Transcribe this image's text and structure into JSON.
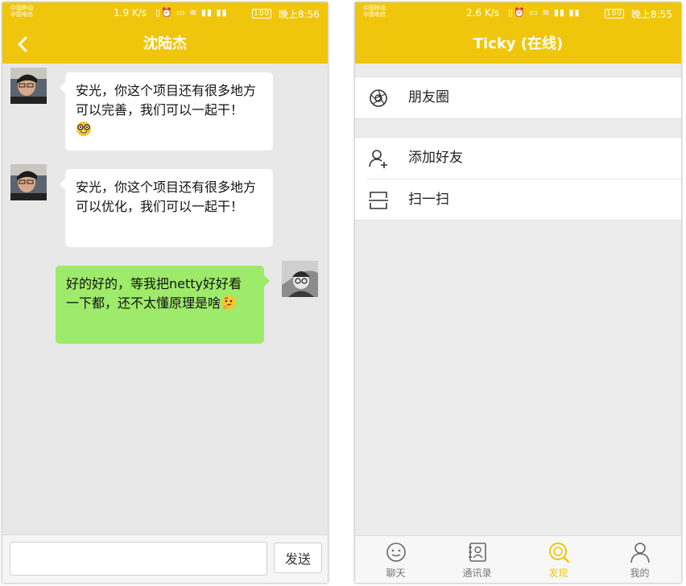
{
  "colors": {
    "accent": "#f0c60c",
    "sent_bubble": "#9eea6a",
    "received_bubble": "#ffffff",
    "chat_bg": "#e8e8e8"
  },
  "chat": {
    "status": {
      "carrier_1": "中国移动",
      "carrier_2": "中国电信",
      "speed": "1.9 K/s",
      "time": "晚上8:56",
      "battery": "100"
    },
    "title": "沈陆杰",
    "messages": [
      {
        "from": "friend",
        "text": "安光，你这个项目还有很多地方可以完善，我们可以一起干！",
        "emoji": "nerd-face"
      },
      {
        "from": "friend",
        "text": "安光，你这个项目还有很多地方可以优化，我们可以一起干！",
        "emoji": ""
      },
      {
        "from": "me",
        "text": "好的好的，等我把netty好好看一下都，还不太懂原理是啥",
        "emoji": "thinking-face"
      }
    ],
    "input": {
      "value": "",
      "placeholder": ""
    },
    "send_label": "发送"
  },
  "discover": {
    "status": {
      "carrier_1": "中国移动",
      "carrier_2": "中国电信",
      "speed": "2.6 K/s",
      "time": "晚上8:55",
      "battery": "100"
    },
    "title": "Ticky (在线)",
    "groups": [
      {
        "items": [
          {
            "label": "朋友圈",
            "icon": "aperture-icon"
          }
        ]
      },
      {
        "items": [
          {
            "label": "添加好友",
            "icon": "add-user-icon"
          },
          {
            "label": "扫一扫",
            "icon": "scan-icon"
          }
        ]
      }
    ],
    "tabs": [
      {
        "label": "聊天",
        "icon": "chat-icon",
        "active": false
      },
      {
        "label": "通讯录",
        "icon": "contacts-icon",
        "active": false
      },
      {
        "label": "发现",
        "icon": "discover-icon",
        "active": true
      },
      {
        "label": "我的",
        "icon": "profile-icon",
        "active": false
      }
    ]
  }
}
